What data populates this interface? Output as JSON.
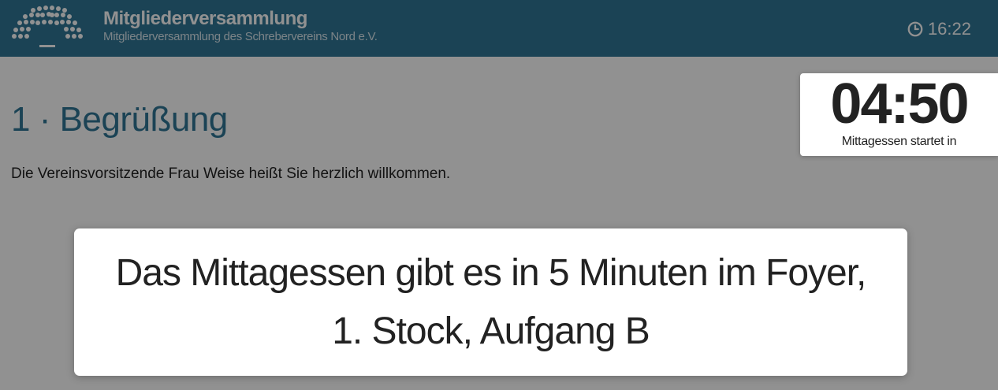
{
  "header": {
    "title": "Mitgliederversammlung",
    "subtitle": "Mitgliederversammlung des Schrebervereins Nord e.V.",
    "clock_icon": "clock-icon",
    "time": "16:22",
    "logo_icon": "parliament-logo-icon"
  },
  "agenda": {
    "title": "1 · Begrüßung",
    "text": "Die Vereinsvorsitzende Frau Weise heißt Sie herzlich willkommen."
  },
  "countdown": {
    "time": "04:50",
    "label": "Mittagessen startet in"
  },
  "message": {
    "line1": "Das Mittagessen gibt es in 5 Minuten im Foyer,",
    "line2": "1. Stock, Aufgang B"
  },
  "colors": {
    "header_bg": "#317796",
    "overlay": "rgba(0,0,0,0.43)",
    "text_dark": "#222222"
  }
}
